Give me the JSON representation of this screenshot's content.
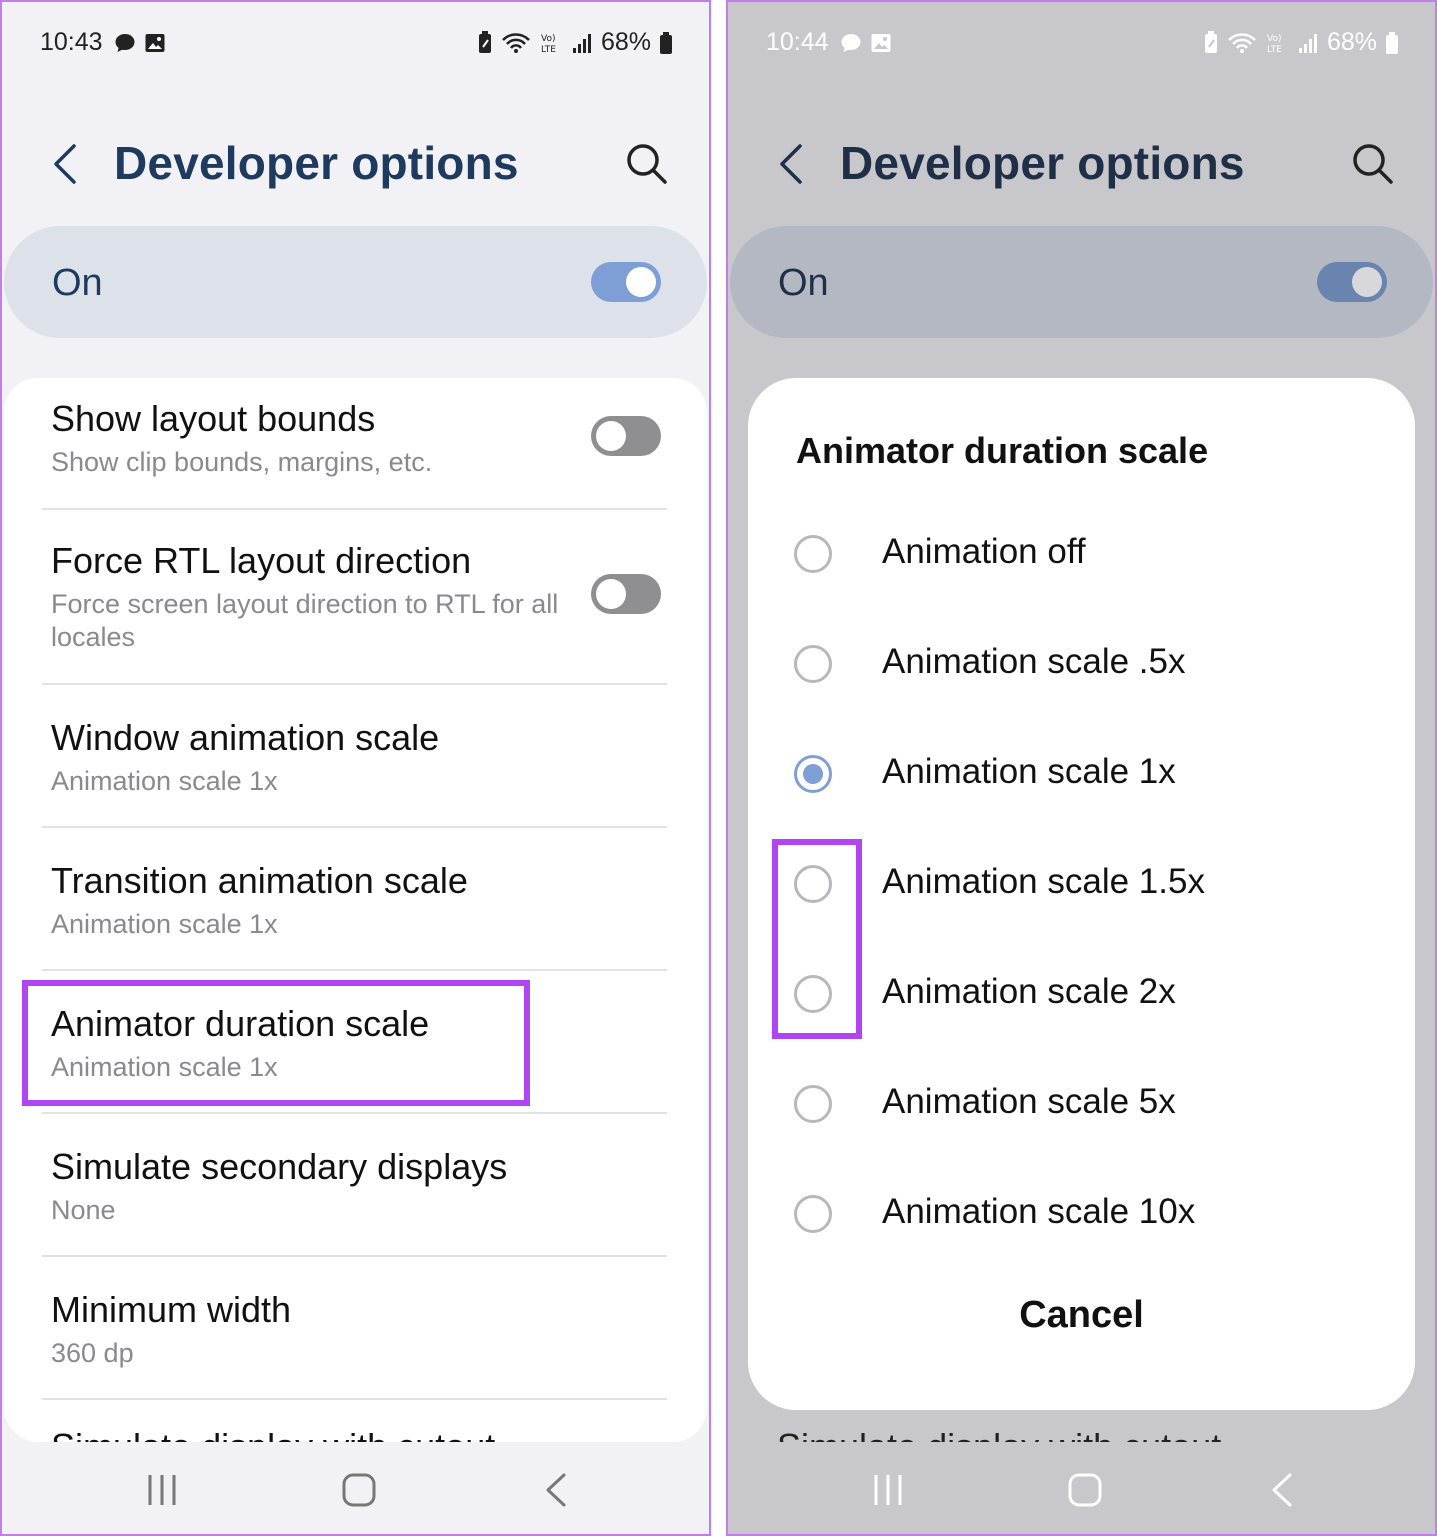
{
  "colors": {
    "accent": "#7e9fd6",
    "highlight": "#b245f2",
    "title": "#1f3a5f"
  },
  "left": {
    "status": {
      "time": "10:43",
      "battery": "68%"
    },
    "title": "Developer options",
    "master": {
      "label": "On",
      "enabled": true
    },
    "items": [
      {
        "primary": "Show layout bounds",
        "secondary": "Show clip bounds, margins, etc.",
        "toggle": false
      },
      {
        "primary": "Force RTL layout direction",
        "secondary": "Force screen layout direction to RTL for all locales",
        "toggle": false
      },
      {
        "primary": "Window animation scale",
        "secondary": "Animation scale 1x"
      },
      {
        "primary": "Transition animation scale",
        "secondary": "Animation scale 1x"
      },
      {
        "primary": "Animator duration scale",
        "secondary": "Animation scale 1x"
      },
      {
        "primary": "Simulate secondary displays",
        "secondary": "None"
      },
      {
        "primary": "Minimum width",
        "secondary": "360 dp"
      }
    ],
    "cutoff_item": "Simulate display with cutout"
  },
  "right": {
    "status": {
      "time": "10:44",
      "battery": "68%"
    },
    "title": "Developer options",
    "master": {
      "label": "On",
      "enabled": true
    },
    "cutoff_item": "Simulate display with cutout",
    "dialog": {
      "title": "Animator duration scale",
      "options": [
        {
          "label": "Animation off",
          "selected": false
        },
        {
          "label": "Animation scale .5x",
          "selected": false
        },
        {
          "label": "Animation scale 1x",
          "selected": true
        },
        {
          "label": "Animation scale 1.5x",
          "selected": false
        },
        {
          "label": "Animation scale 2x",
          "selected": false
        },
        {
          "label": "Animation scale 5x",
          "selected": false
        },
        {
          "label": "Animation scale 10x",
          "selected": false
        }
      ],
      "cancel_label": "Cancel"
    }
  },
  "icons": {
    "back": "chevron-left-icon",
    "search": "search-icon",
    "nav_recents": "recent-apps-icon",
    "nav_home": "home-icon",
    "nav_back": "back-icon"
  }
}
